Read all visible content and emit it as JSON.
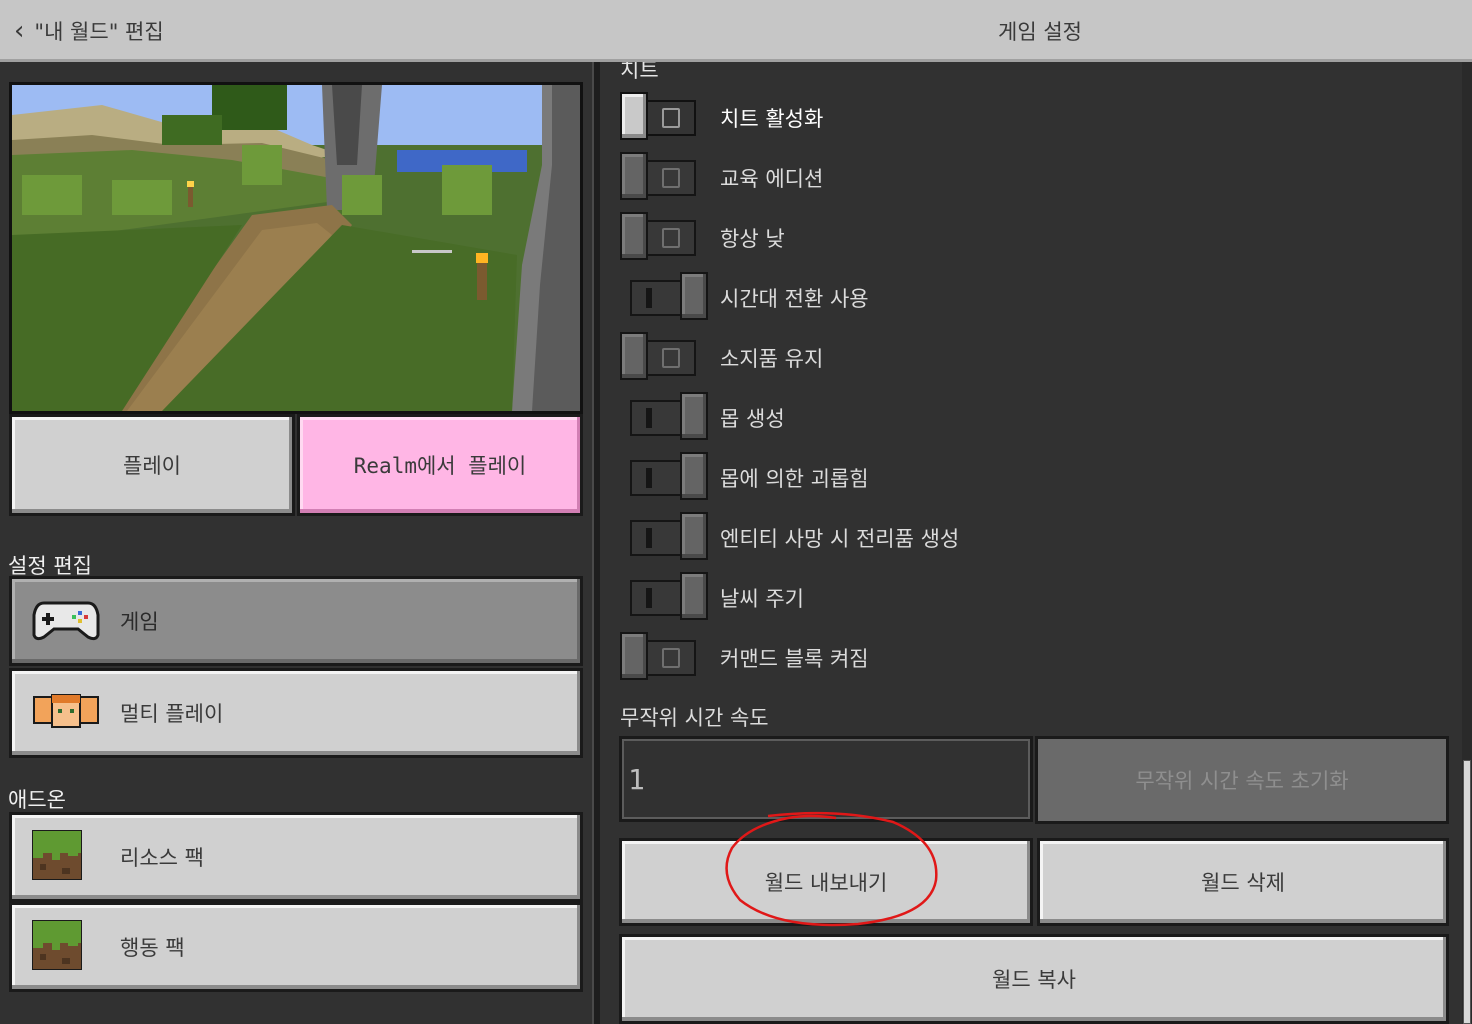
{
  "header": {
    "back_label": "\"내 월드\" 편집",
    "title": "게임 설정"
  },
  "left": {
    "play_label": "플레이",
    "realm_label": "Realm에서 플레이",
    "settings_section": "설정 편집",
    "settings_items": [
      {
        "label": "게임",
        "icon": "controller-icon",
        "selected": true
      },
      {
        "label": "멀티 플레이",
        "icon": "players-icon",
        "selected": false
      }
    ],
    "addons_section": "애드온",
    "addon_items": [
      {
        "label": "리소스 팩",
        "icon": "grass-block-icon"
      },
      {
        "label": "행동 팩",
        "icon": "grass-block-icon"
      }
    ]
  },
  "right": {
    "cut_header": "치트",
    "toggles": [
      {
        "label": "치트 활성화",
        "state": "off",
        "active": true
      },
      {
        "label": "교육 에디션",
        "state": "off",
        "active": false
      },
      {
        "label": "항상 낮",
        "state": "off",
        "active": false
      },
      {
        "label": "시간대 전환 사용",
        "state": "on",
        "active": false
      },
      {
        "label": "소지품 유지",
        "state": "off",
        "active": false
      },
      {
        "label": "몹 생성",
        "state": "on",
        "active": false
      },
      {
        "label": "몹에 의한 괴롭힘",
        "state": "on",
        "active": false
      },
      {
        "label": "엔티티 사망 시 전리품 생성",
        "state": "on",
        "active": false
      },
      {
        "label": "날씨 주기",
        "state": "on",
        "active": false
      },
      {
        "label": "커맨드 블록 켜짐",
        "state": "off",
        "active": false
      }
    ],
    "random_tick_label": "무작위 시간 속도",
    "random_tick_value": "1",
    "reset_label": "무작위 시간 속도 초기화",
    "export_label": "월드 내보내기",
    "delete_label": "월드 삭제",
    "copy_label": "월드 복사"
  },
  "colors": {
    "background": "#313131",
    "button": "#d0d0d0",
    "realm_pink": "#ffb6e5",
    "selected": "#8c8c8c",
    "annotation_red": "#e01818"
  }
}
